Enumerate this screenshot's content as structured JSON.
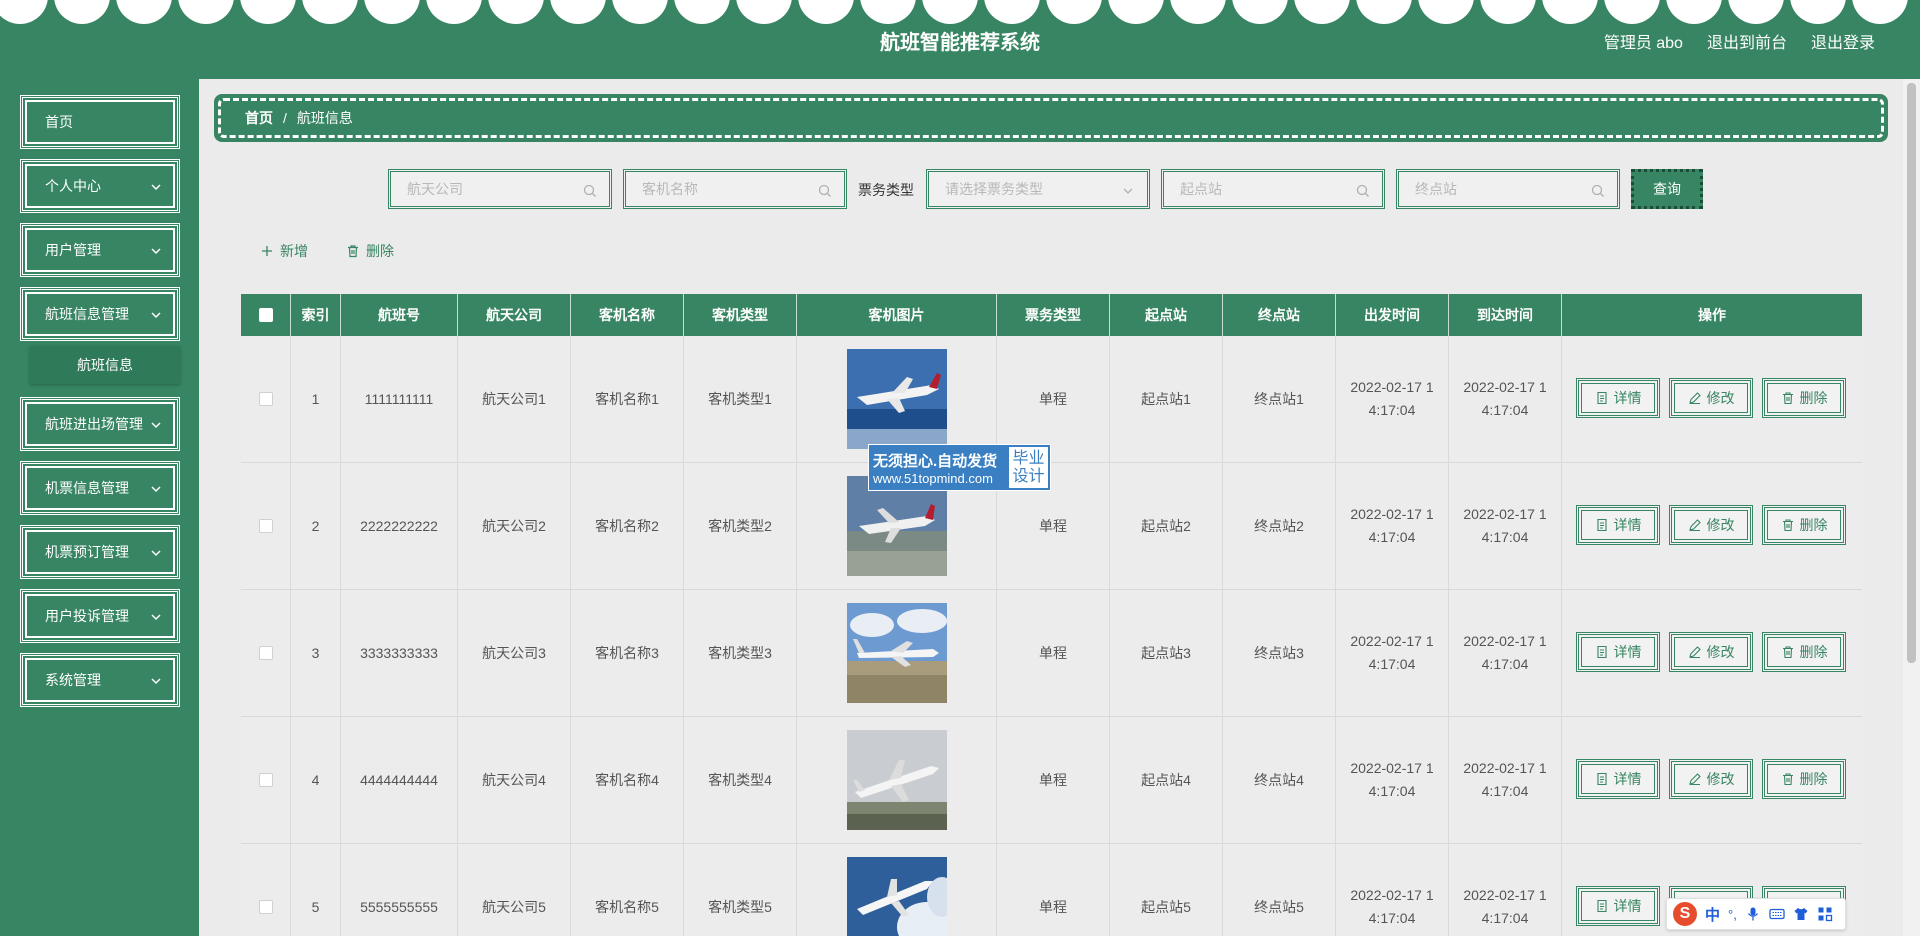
{
  "header": {
    "title": "航班智能推荐系统",
    "user_label": "管理员 abo",
    "to_front_label": "退出到前台",
    "logout_label": "退出登录"
  },
  "sidebar": {
    "items": [
      {
        "label": "首页",
        "icon": ""
      },
      {
        "label": "个人中心",
        "icon": "chevron-down-icon"
      },
      {
        "label": "用户管理",
        "icon": "chevron-down-icon"
      },
      {
        "label": "航班信息管理",
        "icon": "chevron-down-icon"
      },
      {
        "label": "航班进出场管理",
        "icon": "chevron-down-icon"
      },
      {
        "label": "机票信息管理",
        "icon": "chevron-down-icon"
      },
      {
        "label": "机票预订管理",
        "icon": "chevron-down-icon"
      },
      {
        "label": "用户投诉管理",
        "icon": "chevron-down-icon"
      },
      {
        "label": "系统管理",
        "icon": "chevron-down-icon"
      }
    ],
    "submenu": {
      "label": "航班信息"
    }
  },
  "breadcrumb": {
    "home": "首页",
    "separator": "/",
    "current": "航班信息"
  },
  "search": {
    "airline_placeholder": "航天公司",
    "aircraft_name_placeholder": "客机名称",
    "ticket_type_label": "票务类型",
    "ticket_type_placeholder": "请选择票务类型",
    "origin_placeholder": "起点站",
    "destination_placeholder": "终点站",
    "query_label": "查询"
  },
  "actions": {
    "add_label": "新增",
    "delete_label": "删除"
  },
  "table": {
    "columns": [
      "索引",
      "航班号",
      "航天公司",
      "客机名称",
      "客机类型",
      "客机图片",
      "票务类型",
      "起点站",
      "终点站",
      "出发时间",
      "到达时间",
      "操作"
    ],
    "rows": [
      {
        "index": "1",
        "flight_no": "1111111111",
        "airline": "航天公司1",
        "aircraft_name": "客机名称1",
        "aircraft_type": "客机类型1",
        "ticket_type": "单程",
        "origin": "起点站1",
        "destination": "终点站1",
        "depart_l1": "2022-02-17 1",
        "depart_l2": "4:17:04",
        "arrive_l1": "2022-02-17 1",
        "arrive_l2": "4:17:04"
      },
      {
        "index": "2",
        "flight_no": "2222222222",
        "airline": "航天公司2",
        "aircraft_name": "客机名称2",
        "aircraft_type": "客机类型2",
        "ticket_type": "单程",
        "origin": "起点站2",
        "destination": "终点站2",
        "depart_l1": "2022-02-17 1",
        "depart_l2": "4:17:04",
        "arrive_l1": "2022-02-17 1",
        "arrive_l2": "4:17:04"
      },
      {
        "index": "3",
        "flight_no": "3333333333",
        "airline": "航天公司3",
        "aircraft_name": "客机名称3",
        "aircraft_type": "客机类型3",
        "ticket_type": "单程",
        "origin": "起点站3",
        "destination": "终点站3",
        "depart_l1": "2022-02-17 1",
        "depart_l2": "4:17:04",
        "arrive_l1": "2022-02-17 1",
        "arrive_l2": "4:17:04"
      },
      {
        "index": "4",
        "flight_no": "4444444444",
        "airline": "航天公司4",
        "aircraft_name": "客机名称4",
        "aircraft_type": "客机类型4",
        "ticket_type": "单程",
        "origin": "起点站4",
        "destination": "终点站4",
        "depart_l1": "2022-02-17 1",
        "depart_l2": "4:17:04",
        "arrive_l1": "2022-02-17 1",
        "arrive_l2": "4:17:04"
      },
      {
        "index": "5",
        "flight_no": "5555555555",
        "airline": "航天公司5",
        "aircraft_name": "客机名称5",
        "aircraft_type": "客机类型5",
        "ticket_type": "单程",
        "origin": "起点站5",
        "destination": "终点站5",
        "depart_l1": "2022-02-17 1",
        "depart_l2": "4:17:04",
        "arrive_l1": "2022-02-17 1",
        "arrive_l2": "4:17:04"
      }
    ],
    "row_actions": {
      "detail": "详情",
      "edit": "修改",
      "delete": "删除"
    }
  },
  "watermark": {
    "line1": "无须担心.自动发货",
    "line2": "www.51topmind.com",
    "badge1": "毕业",
    "badge2": "设计"
  },
  "ime": {
    "mode": "中",
    "punct": "°,"
  },
  "colors": {
    "primary": "#378562",
    "background": "#ebebeb",
    "text": "#333333",
    "watermark": "#3a7fc2"
  }
}
